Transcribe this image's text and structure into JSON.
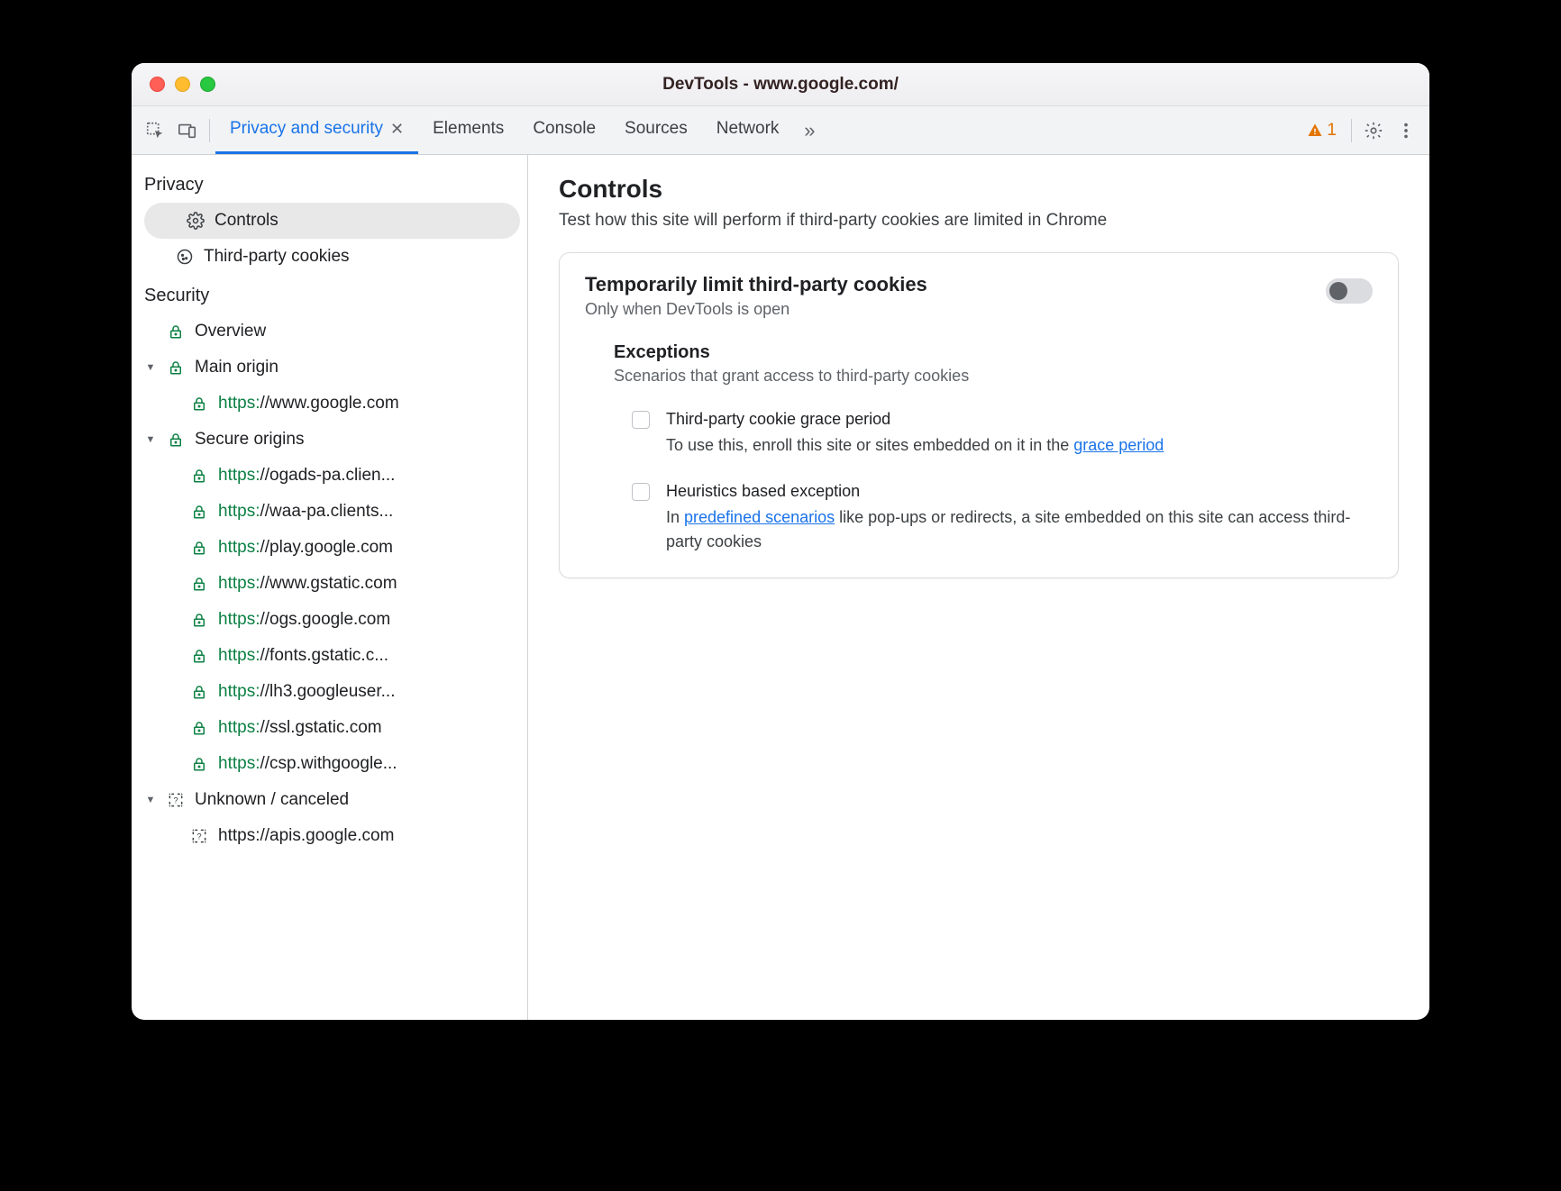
{
  "window": {
    "title": "DevTools - www.google.com/"
  },
  "toolbar": {
    "tabs": [
      {
        "label": "Privacy and security",
        "active": true,
        "closable": true
      },
      {
        "label": "Elements"
      },
      {
        "label": "Console"
      },
      {
        "label": "Sources"
      },
      {
        "label": "Network"
      }
    ],
    "warning_count": "1"
  },
  "sidebar": {
    "sections": [
      {
        "header": "Privacy",
        "items": [
          {
            "icon": "gear",
            "label": "Controls",
            "selected": true
          },
          {
            "icon": "cookie",
            "label": "Third-party cookies"
          }
        ]
      },
      {
        "header": "Security",
        "items": [
          {
            "icon": "lock",
            "label": "Overview"
          },
          {
            "icon": "lock",
            "label": "Main origin",
            "twisty": "down",
            "indent": 0
          },
          {
            "icon": "lock",
            "scheme": "https:",
            "rest": "//www.google.com",
            "indent": 1
          },
          {
            "icon": "lock",
            "label": "Secure origins",
            "twisty": "down",
            "indent": 0
          },
          {
            "icon": "lock",
            "scheme": "https:",
            "rest": "//ogads-pa.clien...",
            "indent": 1
          },
          {
            "icon": "lock",
            "scheme": "https:",
            "rest": "//waa-pa.clients...",
            "indent": 1
          },
          {
            "icon": "lock",
            "scheme": "https:",
            "rest": "//play.google.com",
            "indent": 1
          },
          {
            "icon": "lock",
            "scheme": "https:",
            "rest": "//www.gstatic.com",
            "indent": 1
          },
          {
            "icon": "lock",
            "scheme": "https:",
            "rest": "//ogs.google.com",
            "indent": 1
          },
          {
            "icon": "lock",
            "scheme": "https:",
            "rest": "//fonts.gstatic.c...",
            "indent": 1
          },
          {
            "icon": "lock",
            "scheme": "https:",
            "rest": "//lh3.googleuser...",
            "indent": 1
          },
          {
            "icon": "lock",
            "scheme": "https:",
            "rest": "//ssl.gstatic.com",
            "indent": 1
          },
          {
            "icon": "lock",
            "scheme": "https:",
            "rest": "//csp.withgoogle...",
            "indent": 1
          },
          {
            "icon": "question",
            "label": "Unknown / canceled",
            "twisty": "down",
            "indent": 0
          },
          {
            "icon": "question",
            "label": "https://apis.google.com",
            "indent": 1
          }
        ]
      }
    ]
  },
  "content": {
    "title": "Controls",
    "subtitle": "Test how this site will perform if third-party cookies are limited in Chrome",
    "card": {
      "title": "Temporarily limit third-party cookies",
      "subtitle": "Only when DevTools is open",
      "toggle_on": false,
      "exceptions_title": "Exceptions",
      "exceptions_subtitle": "Scenarios that grant access to third-party cookies",
      "items": [
        {
          "title": "Third-party cookie grace period",
          "desc_pre": "To use this, enroll this site or sites embedded on it in the ",
          "link": "grace period",
          "desc_post": ""
        },
        {
          "title": "Heuristics based exception",
          "desc_pre": "In ",
          "link": "predefined scenarios",
          "desc_post": " like pop-ups or redirects, a site embedded on this site can access third-party cookies"
        }
      ]
    }
  }
}
